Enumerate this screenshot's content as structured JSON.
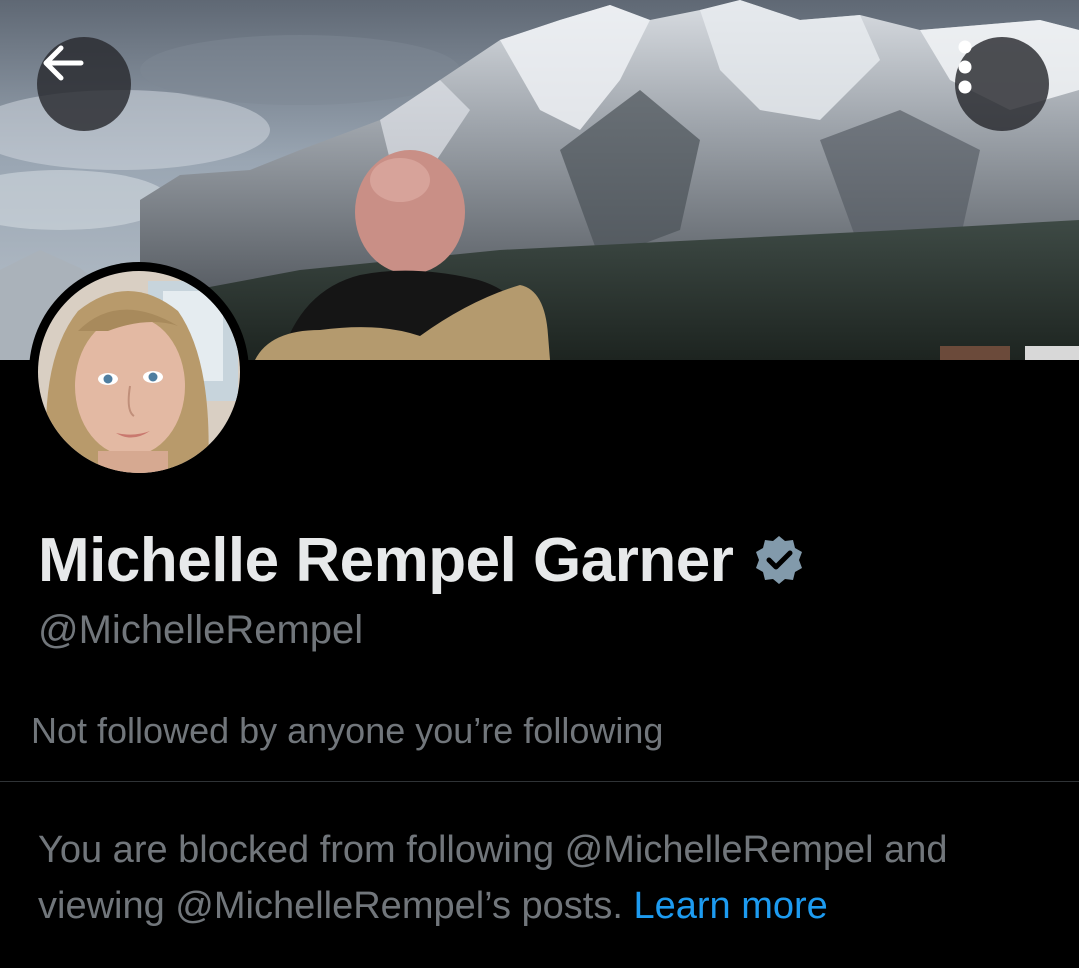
{
  "header": {
    "back_icon": "arrow-left-icon",
    "more_icon": "more-vertical-icon"
  },
  "profile": {
    "display_name": "Michelle Rempel Garner",
    "verified_icon": "verified-badge-icon",
    "handle": "@MichelleRempel",
    "followed_by_text": "Not followed by anyone you’re following"
  },
  "notice": {
    "blocked_text": "You are blocked from following @MichelleRempel and viewing @MichelleRempel’s posts. ",
    "learn_more_label": "Learn more"
  },
  "colors": {
    "background": "#000000",
    "primary_text": "#e7e9ea",
    "secondary_text": "#71767b",
    "link": "#1d9bf0",
    "verified_badge": "#829aab",
    "divider": "#2f3336"
  }
}
